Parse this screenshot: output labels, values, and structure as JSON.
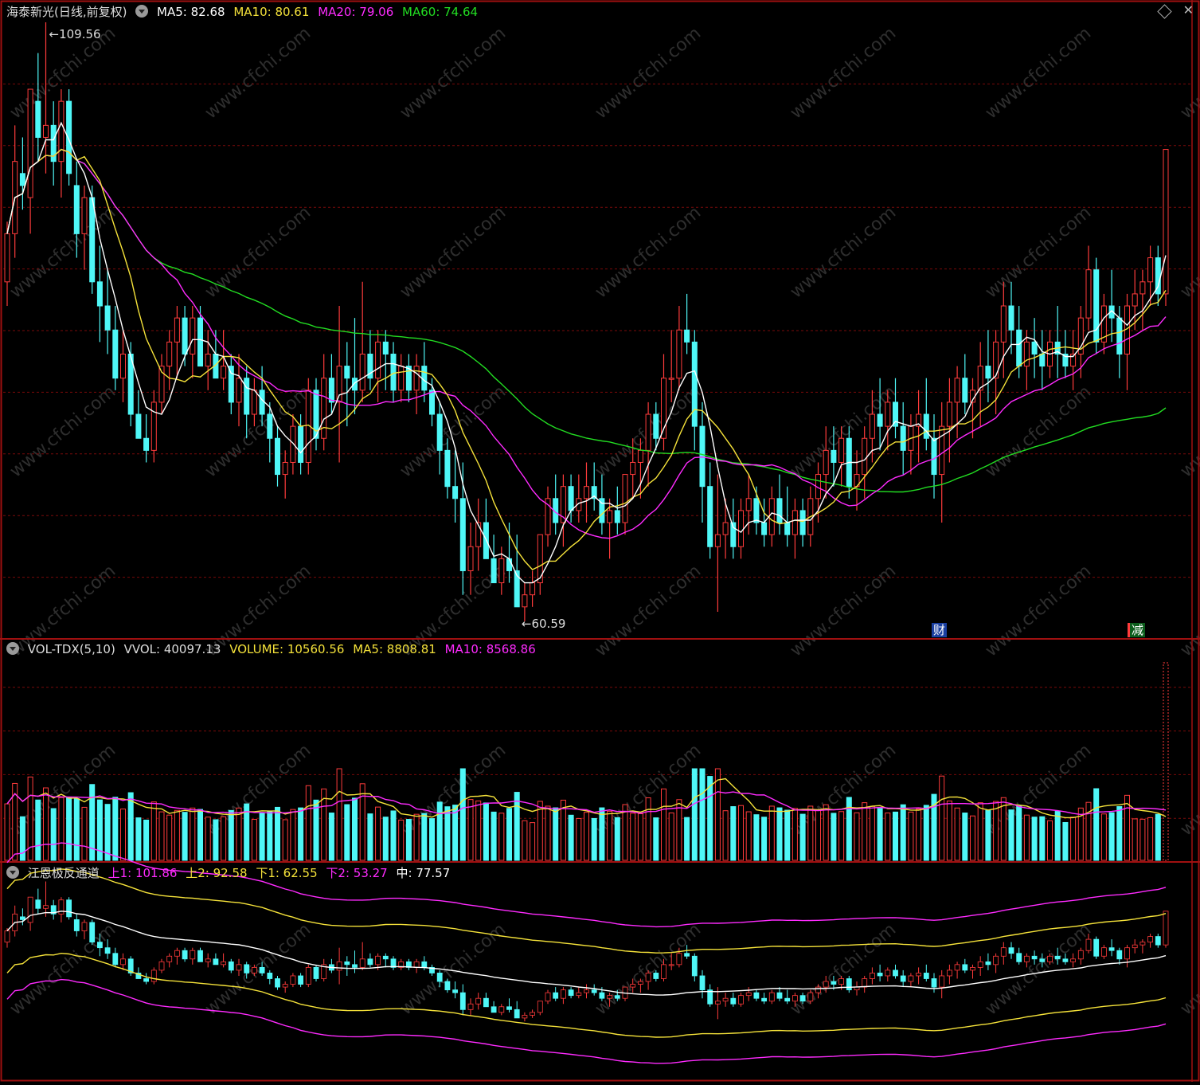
{
  "main_panel": {
    "stock_name": "海泰新光(日线,前复权)",
    "ma": [
      {
        "label": "MA5: 82.68",
        "color": "#ffffff"
      },
      {
        "label": "MA10: 80.61",
        "color": "#f5e23a"
      },
      {
        "label": "MA20: 79.06",
        "color": "#ff2bff"
      },
      {
        "label": "MA60: 74.64",
        "color": "#22dd22"
      }
    ],
    "high_label": "109.56",
    "low_label": "60.59",
    "marker_cai": "财",
    "marker_jian": "减"
  },
  "volume_panel": {
    "title": "VOL-TDX(5,10)",
    "vvol": "VVOL: 40097.13",
    "volume": "VOLUME: 10560.56",
    "ma5": "MA5: 8808.81",
    "ma10": "MA10: 8568.86"
  },
  "channel_panel": {
    "title": "江恩极反通道",
    "up1": "上1: 101.86",
    "up2": "上2: 92.58",
    "down1": "下1: 62.55",
    "down2": "下2: 53.27",
    "mid": "中: 77.57"
  },
  "watermark": "www.cfchi.com",
  "colors": {
    "up": "#ff3b3b",
    "down": "#4ff7f7",
    "ma5": "#ffffff",
    "ma10": "#f5e23a",
    "ma20": "#ff2bff",
    "ma60": "#22dd22",
    "border": "#a01010",
    "grid": "#7a0a0a"
  },
  "chart_data": {
    "type": "candlestick",
    "price_range": [
      60.59,
      109.56
    ],
    "price_series": [
      [
        88,
        93,
        86,
        92
      ],
      [
        92,
        101,
        90,
        98
      ],
      [
        97,
        100,
        94,
        96
      ],
      [
        95,
        104,
        92,
        104
      ],
      [
        103,
        107,
        98,
        100
      ],
      [
        100,
        109.56,
        97,
        101
      ],
      [
        101,
        103,
        96,
        98
      ],
      [
        98,
        104,
        95,
        103
      ],
      [
        103,
        104,
        96,
        97
      ],
      [
        96,
        98,
        90,
        92
      ],
      [
        92,
        96,
        89,
        95
      ],
      [
        95,
        96,
        87,
        88
      ],
      [
        88,
        91,
        83,
        86
      ],
      [
        86,
        89,
        82,
        84
      ],
      [
        84,
        86,
        79,
        80
      ],
      [
        80,
        84,
        78,
        82
      ],
      [
        82,
        83,
        76,
        77
      ],
      [
        77,
        79,
        75,
        75
      ],
      [
        75,
        77,
        73,
        74
      ],
      [
        74,
        79,
        73,
        78
      ],
      [
        78,
        82,
        77,
        81
      ],
      [
        81,
        84,
        79,
        83
      ],
      [
        83,
        86,
        80,
        85
      ],
      [
        85,
        86,
        81,
        82
      ],
      [
        82,
        86,
        80,
        85
      ],
      [
        85,
        86,
        81,
        81
      ],
      [
        81,
        84,
        79,
        82
      ],
      [
        82,
        84,
        80,
        80
      ],
      [
        80,
        84,
        79,
        81
      ],
      [
        81,
        82,
        77,
        78
      ],
      [
        78,
        82,
        76,
        80
      ],
      [
        80,
        81,
        75,
        77
      ],
      [
        77,
        80,
        76,
        79
      ],
      [
        79,
        81,
        76,
        77
      ],
      [
        77,
        78,
        73,
        75
      ],
      [
        75,
        76,
        71,
        72
      ],
      [
        72,
        74,
        70,
        73
      ],
      [
        73,
        77,
        72,
        76
      ],
      [
        76,
        77,
        72,
        73
      ],
      [
        73,
        80,
        72,
        79
      ],
      [
        79,
        80,
        74,
        75
      ],
      [
        75,
        82,
        74,
        80
      ],
      [
        80,
        82,
        77,
        78
      ],
      [
        78,
        86,
        73,
        81
      ],
      [
        81,
        83,
        76,
        80
      ],
      [
        80,
        85,
        77,
        79
      ],
      [
        79,
        88,
        78,
        82
      ],
      [
        82,
        84,
        79,
        80
      ],
      [
        80,
        84,
        78,
        83
      ],
      [
        83,
        84,
        79,
        82
      ],
      [
        82,
        83,
        78,
        79
      ],
      [
        79,
        82,
        78,
        81
      ],
      [
        81,
        82,
        78,
        79
      ],
      [
        79,
        82,
        77,
        81
      ],
      [
        81,
        83,
        78,
        79
      ],
      [
        79,
        80,
        76,
        77
      ],
      [
        77,
        78,
        72,
        74
      ],
      [
        74,
        75,
        70,
        71
      ],
      [
        71,
        74,
        68,
        70
      ],
      [
        70,
        73,
        62,
        64
      ],
      [
        64,
        68,
        62,
        66
      ],
      [
        66,
        70,
        64,
        68
      ],
      [
        68,
        70,
        65,
        65
      ],
      [
        65,
        67,
        63,
        63
      ],
      [
        63,
        66,
        62,
        65
      ],
      [
        65,
        68,
        63,
        64
      ],
      [
        64,
        67,
        61,
        61
      ],
      [
        61,
        63,
        59.8,
        62
      ],
      [
        62,
        64,
        61,
        63
      ],
      [
        63,
        67,
        62,
        67
      ],
      [
        67,
        71,
        66,
        70
      ],
      [
        70,
        72,
        67,
        68
      ],
      [
        68,
        72,
        66,
        71
      ],
      [
        71,
        72,
        68,
        69
      ],
      [
        69,
        72,
        68,
        70
      ],
      [
        70,
        73,
        68,
        71
      ],
      [
        71,
        73,
        69,
        70
      ],
      [
        70,
        72,
        67,
        68
      ],
      [
        68,
        70,
        65,
        69
      ],
      [
        69,
        71,
        67,
        68
      ],
      [
        68,
        72,
        67,
        72
      ],
      [
        72,
        75,
        70,
        73
      ],
      [
        73,
        75,
        70,
        74
      ],
      [
        74,
        78,
        71,
        77
      ],
      [
        77,
        78,
        74,
        75
      ],
      [
        75,
        82,
        74,
        80
      ],
      [
        80,
        84,
        78,
        80
      ],
      [
        80,
        86,
        79,
        84
      ],
      [
        84,
        87,
        82,
        83
      ],
      [
        83,
        84,
        74,
        76
      ],
      [
        76,
        78,
        68,
        71
      ],
      [
        71,
        73,
        65,
        66
      ],
      [
        66,
        72,
        60.59,
        67
      ],
      [
        67,
        70,
        65,
        68
      ],
      [
        68,
        70,
        65,
        66
      ],
      [
        66,
        70,
        65,
        69
      ],
      [
        69,
        72,
        67,
        70
      ],
      [
        70,
        71,
        67,
        68
      ],
      [
        68,
        70,
        66,
        67
      ],
      [
        67,
        71,
        66,
        70
      ],
      [
        70,
        72,
        67,
        68
      ],
      [
        68,
        71,
        66,
        67
      ],
      [
        67,
        70,
        65,
        69
      ],
      [
        69,
        70,
        66,
        67
      ],
      [
        67,
        71,
        66,
        70
      ],
      [
        70,
        73,
        68,
        72
      ],
      [
        72,
        76,
        70,
        74
      ],
      [
        74,
        76,
        71,
        73
      ],
      [
        73,
        76,
        71,
        75
      ],
      [
        75,
        76,
        70,
        71
      ],
      [
        71,
        74,
        69,
        72
      ],
      [
        72,
        76,
        70,
        75
      ],
      [
        75,
        79,
        73,
        77
      ],
      [
        77,
        80,
        74,
        76
      ],
      [
        76,
        79,
        74,
        78
      ],
      [
        78,
        80,
        75,
        76
      ],
      [
        76,
        78,
        72,
        74
      ],
      [
        74,
        77,
        72,
        76
      ],
      [
        76,
        79,
        73,
        77
      ],
      [
        77,
        80,
        74,
        75
      ],
      [
        75,
        77,
        70,
        72
      ],
      [
        72,
        78,
        68,
        76
      ],
      [
        76,
        80,
        73,
        78
      ],
      [
        78,
        81,
        75,
        80
      ],
      [
        80,
        82,
        77,
        78
      ],
      [
        78,
        80,
        75,
        79
      ],
      [
        79,
        83,
        76,
        81
      ],
      [
        81,
        84,
        78,
        80
      ],
      [
        80,
        84,
        77,
        83
      ],
      [
        83,
        88,
        80,
        86
      ],
      [
        86,
        88,
        82,
        84
      ],
      [
        84,
        86,
        80,
        81
      ],
      [
        81,
        84,
        79,
        83
      ],
      [
        83,
        85,
        80,
        82
      ],
      [
        82,
        84,
        79,
        81
      ],
      [
        81,
        84,
        80,
        83
      ],
      [
        83,
        86,
        80,
        82
      ],
      [
        82,
        84,
        80,
        81
      ],
      [
        81,
        84,
        79,
        82
      ],
      [
        82,
        86,
        80,
        85
      ],
      [
        85,
        91,
        84,
        89
      ],
      [
        89,
        90,
        82,
        83
      ],
      [
        83,
        87,
        82,
        86
      ],
      [
        86,
        89,
        83,
        85
      ],
      [
        85,
        86,
        80,
        82
      ],
      [
        82,
        87,
        79,
        86
      ],
      [
        86,
        89,
        84,
        87
      ],
      [
        87,
        89,
        84,
        88
      ],
      [
        88,
        91,
        86,
        90
      ],
      [
        90,
        91,
        86,
        87
      ],
      [
        87,
        99,
        86,
        99
      ]
    ],
    "volume_range": [
      0,
      40097.13
    ],
    "channel_range": [
      53.27,
      101.86
    ]
  }
}
